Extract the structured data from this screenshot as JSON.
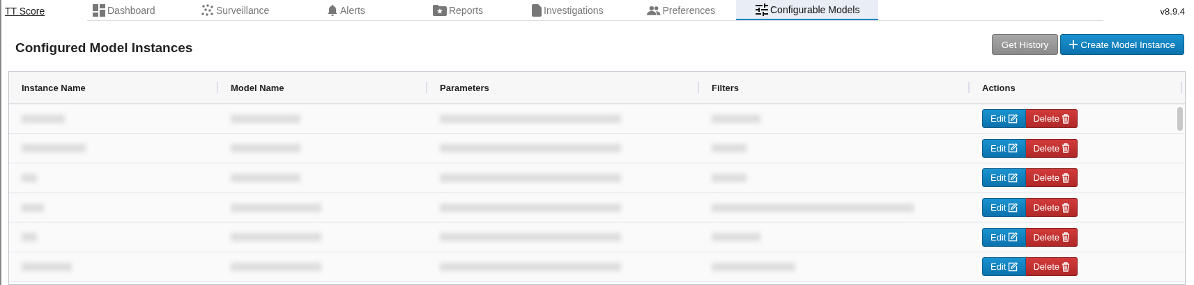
{
  "brand": {
    "label": "TT Score"
  },
  "tabs": [
    {
      "label": "Dashboard",
      "kind": "dashboard",
      "selected": false
    },
    {
      "label": "Surveillance",
      "kind": "dots",
      "selected": false
    },
    {
      "label": "Alerts",
      "kind": "bell",
      "selected": false
    },
    {
      "label": "Reports",
      "kind": "folder-star",
      "selected": false
    },
    {
      "label": "Investigations",
      "kind": "document",
      "selected": false
    },
    {
      "label": "Preferences",
      "kind": "people",
      "selected": false
    },
    {
      "label": "Configurable Models",
      "kind": "sliders",
      "selected": true
    }
  ],
  "version": "v8.9.4",
  "page_title": "Configured Model Instances",
  "buttons": [
    {
      "kind": "secondary",
      "label": "Get History"
    },
    {
      "kind": "primary",
      "label": "Create Model Instance"
    }
  ],
  "table": {
    "columns": [
      "Instance Name",
      "Model Name",
      "Parameters",
      "Filters",
      "Actions"
    ],
    "rows": [
      {
        "edit_label": "Edit",
        "delete_label": "Delete"
      },
      {
        "edit_label": "Edit",
        "delete_label": "Delete"
      },
      {
        "edit_label": "Edit",
        "delete_label": "Delete"
      },
      {
        "edit_label": "Edit",
        "delete_label": "Delete"
      },
      {
        "edit_label": "Edit",
        "delete_label": "Delete"
      },
      {
        "edit_label": "Edit",
        "delete_label": "Delete"
      }
    ]
  }
}
